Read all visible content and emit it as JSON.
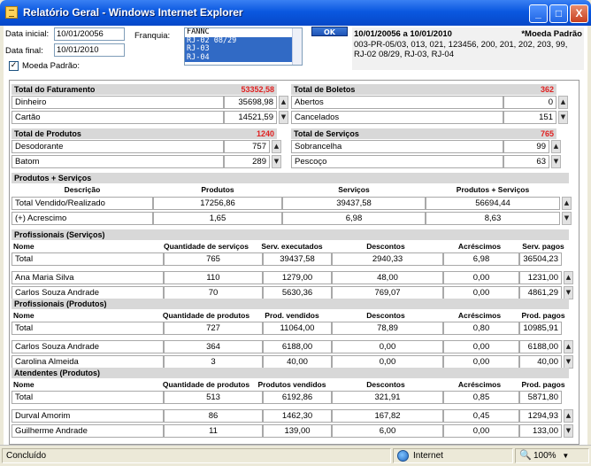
{
  "window": {
    "title": "Relatório Geral - Windows Internet Explorer",
    "min": "_",
    "max": "□",
    "close": "X"
  },
  "form": {
    "data_inicial_label": "Data inicial:",
    "data_inicial_value": "10/01/20056",
    "data_final_label": "Data final:",
    "data_final_value": "10/01/2010",
    "moeda_label": "Moeda Padrão:",
    "franquia_label": "Franquia:",
    "franquia_options": [
      "FANNC",
      "RJ-02 08/29",
      "RJ-03",
      "RJ-04"
    ],
    "ok_label": "OK"
  },
  "info": {
    "period": "10/01/20056 a 10/01/2010",
    "moeda": "*Moeda Padrão",
    "codes": "003-PR-05/03, 013, 021, 123456, 200, 201, 202, 203, 99, RJ-02 08/29, RJ-03, RJ-04"
  },
  "faturamento": {
    "title": "Total do Faturamento",
    "total": "53352,58",
    "rows": [
      {
        "label": "Dinheiro",
        "value": "35698,98"
      },
      {
        "label": "Cartão",
        "value": "14521,59"
      }
    ]
  },
  "boletos": {
    "title": "Total de Boletos",
    "total": "362",
    "rows": [
      {
        "label": "Abertos",
        "value": "0"
      },
      {
        "label": "Cancelados",
        "value": "151"
      }
    ]
  },
  "produtos": {
    "title": "Total de Produtos",
    "total": "1240",
    "rows": [
      {
        "label": "Desodorante",
        "value": "757"
      },
      {
        "label": "Batom",
        "value": "289"
      }
    ]
  },
  "servicos": {
    "title": "Total de Serviços",
    "total": "765",
    "rows": [
      {
        "label": "Sobrancelha",
        "value": "99"
      },
      {
        "label": "Pescoço",
        "value": "63"
      }
    ]
  },
  "ps": {
    "title": "Produtos + Serviços",
    "headers": [
      "Descrição",
      "Produtos",
      "Serviços",
      "Produtos + Serviços"
    ],
    "rows": [
      [
        "Total Vendido/Realizado",
        "17256,86",
        "39437,58",
        "56694,44"
      ],
      [
        "(+) Acrescimo",
        "1,65",
        "6,98",
        "8,63"
      ]
    ]
  },
  "profserv": {
    "title": "Profissionais (Serviços)",
    "headers": [
      "Nome",
      "Quantidade de serviços",
      "Serv. executados",
      "Descontos",
      "Acréscimos",
      "Serv. pagos"
    ],
    "rows": [
      [
        "Total",
        "765",
        "39437,58",
        "2940,33",
        "6,98",
        "36504,23"
      ],
      [
        "Ana Maria Silva",
        "110",
        "1279,00",
        "48,00",
        "0,00",
        "1231,00"
      ],
      [
        "Carlos Souza Andrade",
        "70",
        "5630,36",
        "769,07",
        "0,00",
        "4861,29"
      ]
    ]
  },
  "profprod": {
    "title": "Profissionais (Produtos)",
    "headers": [
      "Nome",
      "Quantidade de produtos",
      "Prod. vendidos",
      "Descontos",
      "Acréscimos",
      "Prod. pagos"
    ],
    "rows": [
      [
        "Total",
        "727",
        "11064,00",
        "78,89",
        "0,80",
        "10985,91"
      ],
      [
        "Carlos Souza Andrade",
        "364",
        "6188,00",
        "0,00",
        "0,00",
        "6188,00"
      ],
      [
        "Carolina Almeida",
        "3",
        "40,00",
        "0,00",
        "0,00",
        "40,00"
      ]
    ]
  },
  "atend": {
    "title": "Atendentes (Produtos)",
    "headers": [
      "Nome",
      "Quantidade de produtos",
      "Produtos vendidos",
      "Descontos",
      "Acréscimos",
      "Prod. pagos"
    ],
    "rows": [
      [
        "Total",
        "513",
        "6192,86",
        "321,91",
        "0,85",
        "5871,80"
      ],
      [
        "Durval Amorim",
        "86",
        "1462,30",
        "167,82",
        "0,45",
        "1294,93"
      ],
      [
        "Guilherme Andrade",
        "11",
        "139,00",
        "6,00",
        "0,00",
        "133,00"
      ]
    ]
  },
  "status": {
    "text": "Concluído",
    "zone": "Internet",
    "zoom": "100%"
  }
}
